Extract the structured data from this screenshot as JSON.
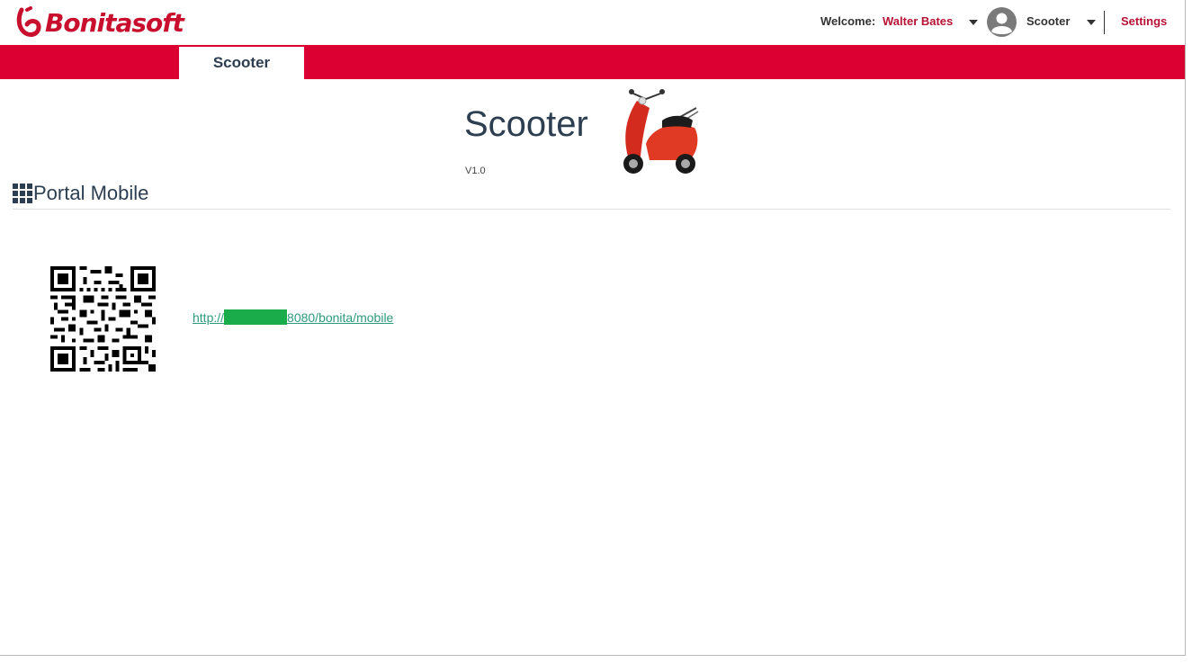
{
  "header": {
    "brand": "Bonitasoft",
    "welcome_label": "Welcome:",
    "user_name": "Walter Bates",
    "profile_name": "Scooter",
    "settings_label": "Settings",
    "colors": {
      "brand": "#c8102e",
      "accent": "#dc0032",
      "link": "#b71234"
    }
  },
  "nav": {
    "tabs": [
      {
        "label": "Scooter",
        "active": true
      }
    ]
  },
  "app": {
    "title": "Scooter",
    "version": "V1.0",
    "image": "scooter-image"
  },
  "section": {
    "title": "Portal Mobile",
    "icon": "grid-icon"
  },
  "mobile": {
    "qr_icon": "qr-code-icon",
    "link_prefix": "http://",
    "link_suffix": "8080/bonita/mobile",
    "link_color": "#2e9a7c"
  }
}
